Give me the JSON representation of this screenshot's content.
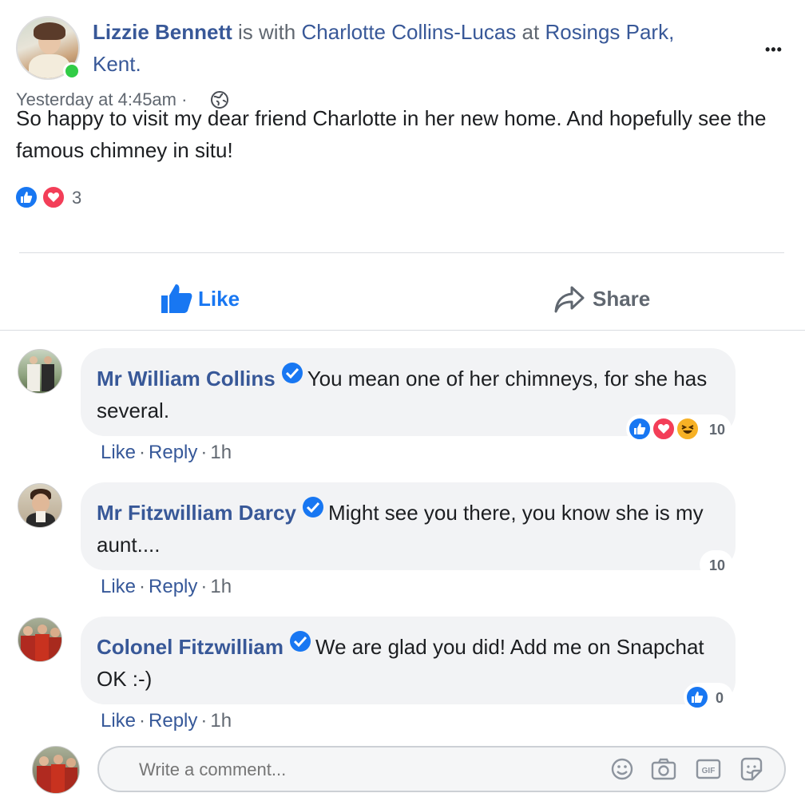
{
  "post": {
    "author": "Lizzie Bennett",
    "with_text": "is with",
    "with_person": "Charlotte Collins-Lucas",
    "at_text": "at",
    "location_line1": "Rosings Park,",
    "location_line2": "Kent.",
    "timestamp": "Yesterday at 4:45am",
    "dot": "·",
    "body": "So happy to visit my dear friend Charlotte in her new home. And hopefully see the famous chimney in situ!",
    "reaction_count": "3",
    "more_menu": "•••",
    "reaction_icons": [
      "like-icon",
      "love-icon"
    ]
  },
  "actions": {
    "like_label": "Like",
    "share_label": "Share"
  },
  "comments": [
    {
      "author": "Mr William Collins",
      "text": "You mean one of her chimneys, for she has several.",
      "like": "Like",
      "reply": "Reply",
      "time": "1h",
      "reaction_count": "10",
      "reaction_icons": [
        "like-icon",
        "love-icon",
        "haha-icon"
      ]
    },
    {
      "author": "Mr Fitzwilliam Darcy",
      "text": "Might see you there, you know she is my aunt....",
      "like": "Like",
      "reply": "Reply",
      "time": "1h",
      "reaction_count": "10",
      "reaction_icons": []
    },
    {
      "author": "Colonel Fitzwilliam",
      "text": "We are glad you did! Add me on Snapchat OK :-)",
      "like": "Like",
      "reply": "Reply",
      "time": "1h",
      "reaction_count": "0",
      "reaction_icons": [
        "like-icon"
      ]
    }
  ],
  "composer": {
    "placeholder": "Write a comment...",
    "icons": [
      "emoji-icon",
      "camera-icon",
      "gif-icon",
      "sticker-icon"
    ]
  },
  "colors": {
    "link": "#385898",
    "like_blue": "#1877f2",
    "love_red": "#f33e58",
    "online_green": "#31cc46",
    "bubble_bg": "#f2f3f5"
  }
}
